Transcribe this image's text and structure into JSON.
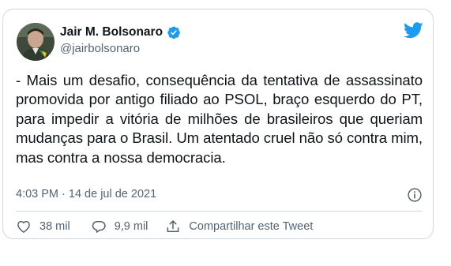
{
  "colors": {
    "accent": "#1d9bf0",
    "text": "#0f1419",
    "secondary": "#536471",
    "border": "#cfd9de"
  },
  "author": {
    "name": "Jair M. Bolsonaro",
    "handle": "@jairbolsonaro",
    "verified": true,
    "avatar_icon": "profile-photo"
  },
  "logo_icon": "twitter-bird-icon",
  "tweet": {
    "text": "- Mais um desafio, consequência da tentativa de assassinato promovida por antigo filiado ao PSOL, braço esquerdo do PT, para impedir a vitória de milhões de brasileiros que queriam mudanças para o Brasil. Um atentado cruel não só contra mim, mas contra a nossa democracia.",
    "timestamp": "4:03 PM · 14 de jul de 2021",
    "info_icon": "info-icon"
  },
  "actions": {
    "likes_count": "38 mil",
    "likes_icon": "heart-icon",
    "replies_count": "9,9 mil",
    "replies_icon": "reply-bubble-icon",
    "share_label": "Compartilhar este Tweet",
    "share_icon": "share-icon"
  }
}
